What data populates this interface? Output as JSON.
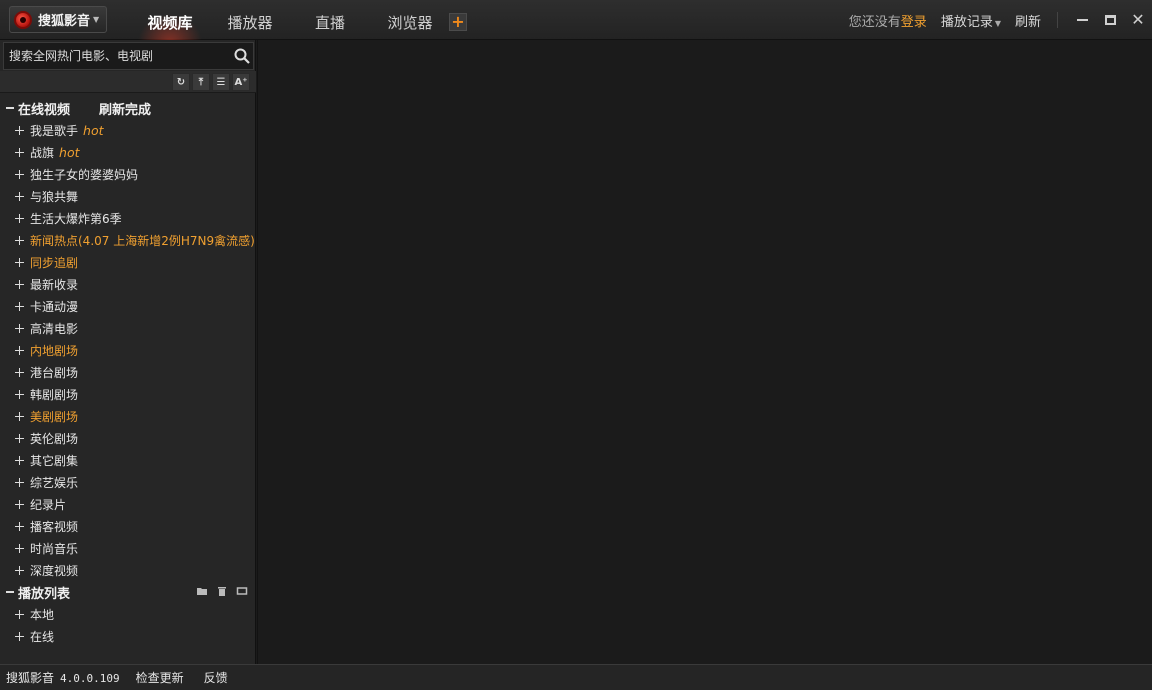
{
  "app": {
    "brand": "搜狐影音",
    "version_name": "搜狐影音",
    "version": "4.0.0.109"
  },
  "tabs": [
    {
      "label": "视频库",
      "active": true
    },
    {
      "label": "播放器",
      "active": false
    },
    {
      "label": "直播",
      "active": false
    },
    {
      "label": "浏览器",
      "active": false
    }
  ],
  "add_tab_symbol": "+",
  "header": {
    "login_prompt": "您还没有",
    "login_link": "登录",
    "history_label": "播放记录",
    "refresh_label": "刷新"
  },
  "window_controls": [
    "minimize",
    "maximize",
    "close"
  ],
  "search": {
    "placeholder": "搜索全网热门电影、电视剧"
  },
  "tools": [
    "sync-icon",
    "top-icon",
    "sort-icon",
    "font-size-icon"
  ],
  "tool_glyphs": [
    "↻",
    "⤒",
    "☰",
    "A⁺"
  ],
  "online_section": {
    "title": "在线视频",
    "status": "刷新完成",
    "items": [
      {
        "label": "我是歌手",
        "hot": "hot",
        "orange": false
      },
      {
        "label": "战旗",
        "hot": "hot",
        "orange": false
      },
      {
        "label": "独生子女的婆婆妈妈",
        "hot": "",
        "orange": false
      },
      {
        "label": "与狼共舞",
        "hot": "",
        "orange": false
      },
      {
        "label": "生活大爆炸第6季",
        "hot": "",
        "orange": false
      },
      {
        "label": "新闻热点(4.07 上海新增2例H7N9禽流感)",
        "hot": "",
        "orange": true
      },
      {
        "label": "同步追剧",
        "hot": "",
        "orange": true
      },
      {
        "label": "最新收录",
        "hot": "",
        "orange": false
      },
      {
        "label": "卡通动漫",
        "hot": "",
        "orange": false
      },
      {
        "label": "高清电影",
        "hot": "",
        "orange": false
      },
      {
        "label": "内地剧场",
        "hot": "",
        "orange": true
      },
      {
        "label": "港台剧场",
        "hot": "",
        "orange": false
      },
      {
        "label": "韩剧剧场",
        "hot": "",
        "orange": false
      },
      {
        "label": "美剧剧场",
        "hot": "",
        "orange": true
      },
      {
        "label": "英伦剧场",
        "hot": "",
        "orange": false
      },
      {
        "label": "其它剧集",
        "hot": "",
        "orange": false
      },
      {
        "label": "综艺娱乐",
        "hot": "",
        "orange": false
      },
      {
        "label": "纪录片",
        "hot": "",
        "orange": false
      },
      {
        "label": "播客视频",
        "hot": "",
        "orange": false
      },
      {
        "label": "时尚音乐",
        "hot": "",
        "orange": false
      },
      {
        "label": "深度视频",
        "hot": "",
        "orange": false
      }
    ]
  },
  "playlist_section": {
    "title": "播放列表",
    "tools": [
      "folder-icon",
      "trash-icon",
      "loop-icon"
    ],
    "items": [
      {
        "label": "本地"
      },
      {
        "label": "在线"
      }
    ]
  },
  "statusbar": {
    "check_update": "检查更新",
    "feedback": "反馈"
  },
  "colors": {
    "accent_orange": "#f0a030",
    "background": "#1b1b1b",
    "sidebar": "#262626"
  }
}
